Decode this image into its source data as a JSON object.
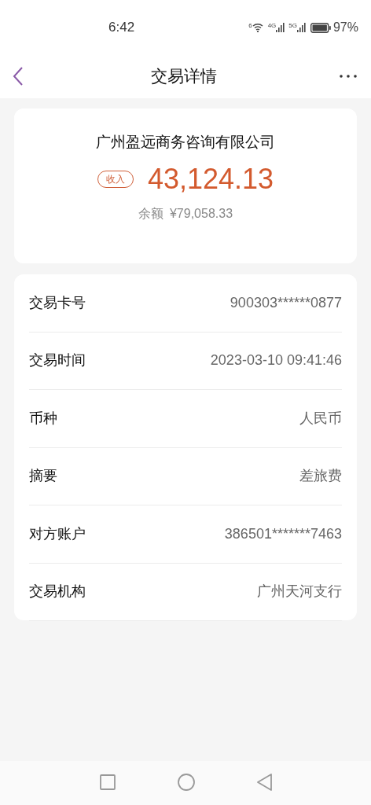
{
  "status_bar": {
    "time": "6:42",
    "wifi_label": "6",
    "networks": [
      {
        "label": "4G"
      },
      {
        "label": "5G"
      }
    ],
    "battery": "97%"
  },
  "header": {
    "title": "交易详情"
  },
  "summary": {
    "payee": "广州盈远商务咨询有限公司",
    "type_badge": "收入",
    "amount": "43,124.13",
    "balance_label": "余额",
    "balance": "¥79,058.33"
  },
  "details": [
    {
      "label": "交易卡号",
      "value": "900303******0877"
    },
    {
      "label": "交易时间",
      "value": "2023-03-10 09:41:46"
    },
    {
      "label": "币种",
      "value": "人民币"
    },
    {
      "label": "摘要",
      "value": "差旅费"
    },
    {
      "label": "对方账户",
      "value": "386501*******7463"
    },
    {
      "label": "交易机构",
      "value": "广州天河支行"
    }
  ]
}
